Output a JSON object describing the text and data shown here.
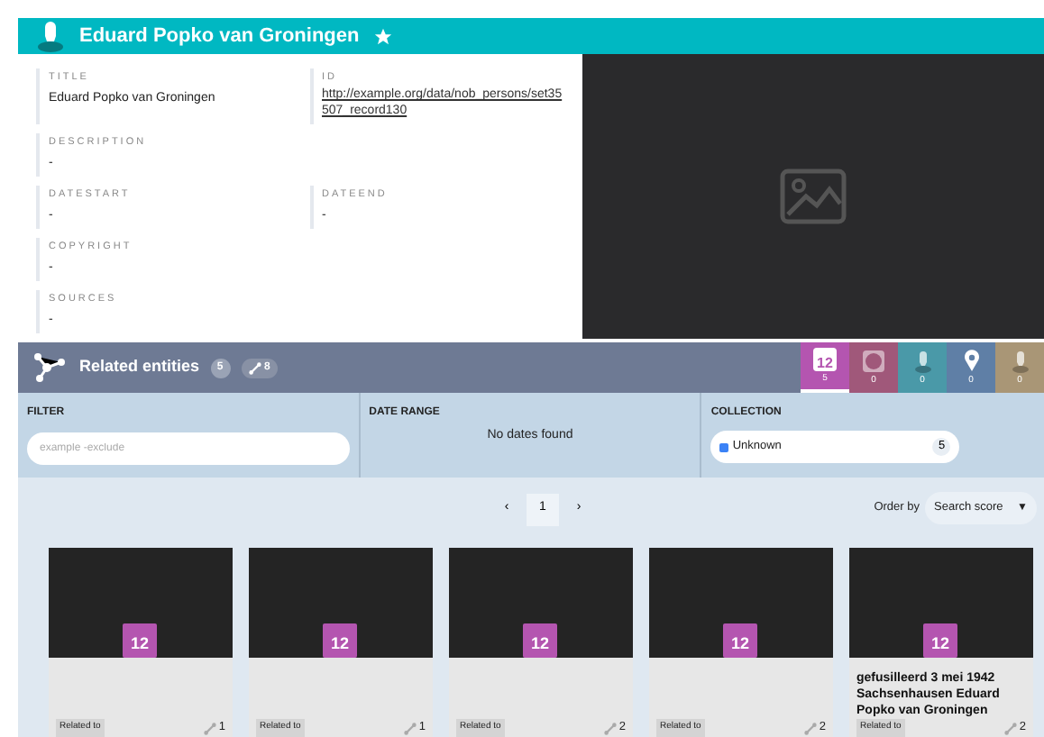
{
  "header": {
    "title": "Eduard Popko van Groningen",
    "favorite": true
  },
  "fields": [
    {
      "label": "TITLE",
      "value": "Eduard Popko van Groningen",
      "kind": "text"
    },
    {
      "label": "ID",
      "value": "http://example.org/data/nob_persons/set35507_record130",
      "kind": "link"
    },
    {
      "label": "DESCRIPTION",
      "value": "-",
      "kind": "text"
    },
    {
      "kind": "spacer"
    },
    {
      "label": "DATESTART",
      "value": "-",
      "kind": "text"
    },
    {
      "label": "DATEEND",
      "value": "-",
      "kind": "text"
    },
    {
      "label": "COPYRIGHT",
      "value": "-",
      "kind": "text"
    },
    {
      "kind": "spacer"
    },
    {
      "label": "SOURCES",
      "value": "-",
      "kind": "text"
    }
  ],
  "related": {
    "title": "Related entities",
    "count": "5",
    "link_count": "8",
    "type_tabs": [
      {
        "kind": "event",
        "icon_text": "12",
        "count": "5",
        "color": "#b455b0",
        "selected": true
      },
      {
        "kind": "object",
        "count": "0",
        "color": "#a0587a",
        "selected": false
      },
      {
        "kind": "person",
        "count": "0",
        "color": "#4a99a8",
        "selected": false
      },
      {
        "kind": "place",
        "count": "0",
        "color": "#5f7fa6",
        "selected": false
      },
      {
        "kind": "person",
        "count": "0",
        "color": "#a99676",
        "selected": false
      }
    ]
  },
  "filter": {
    "label": "FILTER",
    "placeholder": "example -exclude"
  },
  "date_range": {
    "label": "DATE RANGE",
    "message": "No dates found"
  },
  "collection": {
    "label": "COLLECTION",
    "items": [
      {
        "name": "Unknown",
        "count": "5",
        "checked": true
      }
    ]
  },
  "pagination": {
    "prev": "‹",
    "pages": [
      {
        "label": "1",
        "selected": true
      }
    ],
    "next": "›"
  },
  "order": {
    "label": "Order by",
    "value": "Search score",
    "caret": "▼"
  },
  "cards": [
    {
      "icon_text": "12",
      "tag": "Related to",
      "links": "1"
    },
    {
      "icon_text": "12",
      "tag": "Related to",
      "links": "1"
    },
    {
      "icon_text": "12",
      "tag": "Related to",
      "links": "2"
    },
    {
      "icon_text": "12",
      "tag": "Related to",
      "links": "2"
    },
    {
      "icon_text": "12",
      "title": "gefusilleerd 3 mei 1942 Sachsenhausen Eduard Popko van Groningen",
      "tag": "Related to",
      "links": "2"
    }
  ]
}
